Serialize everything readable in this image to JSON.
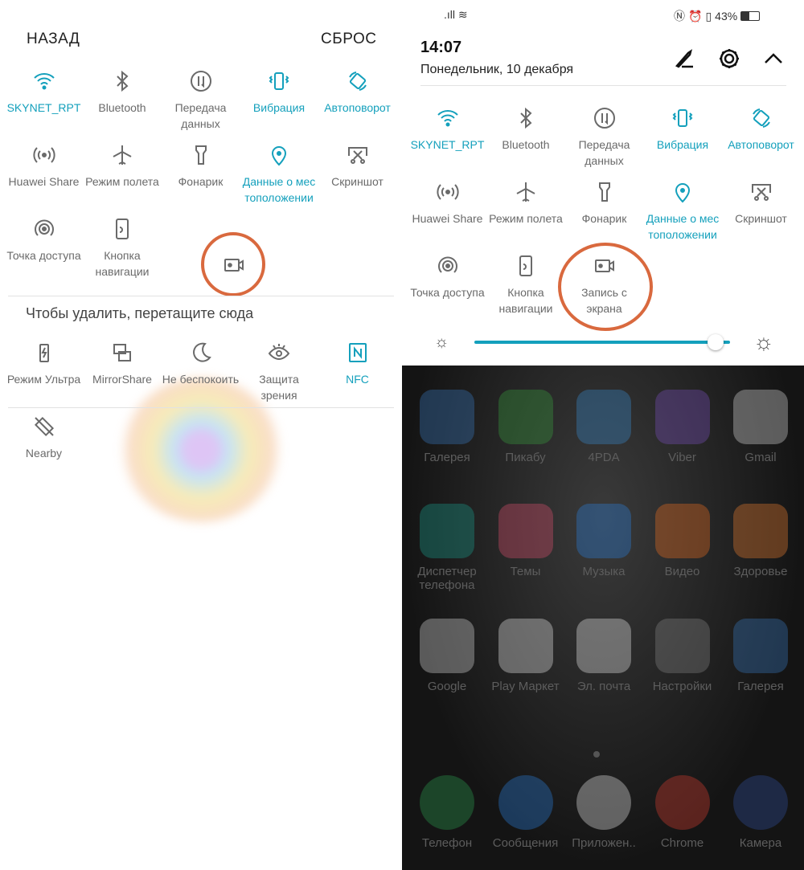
{
  "left": {
    "back_label": "НАЗАД",
    "reset_label": "СБРОС",
    "active_tiles": [
      {
        "label": "SKYNET_RPT",
        "icon": "wifi-icon",
        "active": true
      },
      {
        "label": "Bluetooth",
        "icon": "bluetooth-icon",
        "active": false
      },
      {
        "label": "Передача данных",
        "icon": "mobile-data-icon",
        "active": false
      },
      {
        "label": "Вибрация",
        "icon": "vibration-icon",
        "active": true
      },
      {
        "label": "Автоповорот",
        "icon": "auto-rotate-icon",
        "active": true
      },
      {
        "label": "Huawei Share",
        "icon": "huawei-share-icon",
        "active": false
      },
      {
        "label": "Режим полета",
        "icon": "airplane-icon",
        "active": false
      },
      {
        "label": "Фонарик",
        "icon": "flashlight-icon",
        "active": false
      },
      {
        "label": "Данные о мес тоположении",
        "icon": "location-icon",
        "active": true
      },
      {
        "label": "Скриншот",
        "icon": "screenshot-icon",
        "active": false
      },
      {
        "label": "Точка доступа",
        "icon": "hotspot-icon",
        "active": false
      },
      {
        "label": "Кнопка навигации",
        "icon": "nav-button-icon",
        "active": false
      },
      {
        "label": "",
        "icon": "screen-record-icon",
        "active": false
      }
    ],
    "remove_hint": "Чтобы удалить, перетащите сюда",
    "inactive_tiles": [
      {
        "label": "Режим Ультра",
        "icon": "battery-ultra-icon",
        "active": false
      },
      {
        "label": "MirrorShare",
        "icon": "mirror-share-icon",
        "active": false
      },
      {
        "label": "Не беспокоить",
        "icon": "moon-icon",
        "active": false
      },
      {
        "label": "Защита зрения",
        "icon": "eye-icon",
        "active": false
      },
      {
        "label": "NFC",
        "icon": "nfc-icon",
        "active": true
      },
      {
        "label": "Nearby",
        "icon": "nearby-icon",
        "active": false
      }
    ]
  },
  "right": {
    "status": {
      "battery": "43%"
    },
    "time": "14:07",
    "date": "Понедельник, 10 декабря",
    "tiles": [
      {
        "label": "SKYNET_RPT",
        "icon": "wifi-icon",
        "active": true
      },
      {
        "label": "Bluetooth",
        "icon": "bluetooth-icon",
        "active": false
      },
      {
        "label": "Передача данных",
        "icon": "mobile-data-icon",
        "active": false
      },
      {
        "label": "Вибрация",
        "icon": "vibration-icon",
        "active": true
      },
      {
        "label": "Автоповорот",
        "icon": "auto-rotate-icon",
        "active": true
      },
      {
        "label": "Huawei Share",
        "icon": "huawei-share-icon",
        "active": false
      },
      {
        "label": "Режим полета",
        "icon": "airplane-icon",
        "active": false
      },
      {
        "label": "Фонарик",
        "icon": "flashlight-icon",
        "active": false
      },
      {
        "label": "Данные о мес тоположении",
        "icon": "location-icon",
        "active": true
      },
      {
        "label": "Скриншот",
        "icon": "screenshot-icon",
        "active": false
      },
      {
        "label": "Точка доступа",
        "icon": "hotspot-icon",
        "active": false
      },
      {
        "label": "Кнопка навигации",
        "icon": "nav-button-icon",
        "active": false
      },
      {
        "label": "Запись с экрана",
        "icon": "screen-record-icon",
        "active": false
      }
    ],
    "brightness": 0.95,
    "apps": [
      {
        "label": "Галерея",
        "color": "#3a7cc4"
      },
      {
        "label": "Пикабу",
        "color": "#3aa040"
      },
      {
        "label": "4PDA",
        "color": "#3a8bd0"
      },
      {
        "label": "Viber",
        "color": "#7a4fc0"
      },
      {
        "label": "Gmail",
        "color": "#e0e0e0"
      },
      {
        "label": "Диспетчер телефона",
        "color": "#1aa090"
      },
      {
        "label": "Темы",
        "color": "#e05070"
      },
      {
        "label": "Музыка",
        "color": "#2a80e0"
      },
      {
        "label": "Видео",
        "color": "#f07020"
      },
      {
        "label": "Здоровье",
        "color": "#f08030"
      },
      {
        "label": "Google",
        "color": "#dddddd"
      },
      {
        "label": "Play Маркет",
        "color": "#eeeeee"
      },
      {
        "label": "Эл. почта",
        "color": "#eeeeee"
      },
      {
        "label": "Настройки",
        "color": "#888888"
      },
      {
        "label": "Галерея",
        "color": "#3a7cc4"
      },
      {
        "label": "Телефон",
        "color": "#2aa050"
      },
      {
        "label": "Сообщения",
        "color": "#2a80e0"
      },
      {
        "label": "Приложен..",
        "color": "#eeeeee"
      },
      {
        "label": "Chrome",
        "color": "#e04030"
      },
      {
        "label": "Камера",
        "color": "#3050a0"
      }
    ]
  },
  "colors": {
    "accent": "#14a0bc",
    "highlight_ring": "#d9693e"
  }
}
